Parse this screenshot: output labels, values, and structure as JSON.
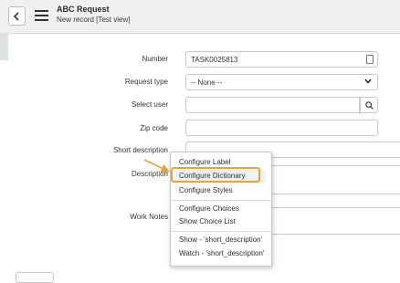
{
  "header": {
    "title": "ABC Request",
    "subtitle": "New record [Test view]"
  },
  "form": {
    "number": {
      "label": "Number",
      "value": "TASK0025813"
    },
    "request_type": {
      "label": "Request type",
      "value": "-- None --"
    },
    "select_user": {
      "label": "Select user",
      "value": ""
    },
    "zip_code": {
      "label": "Zip code",
      "value": ""
    },
    "short_description": {
      "label": "Short description",
      "value": ""
    },
    "description": {
      "label": "Description"
    },
    "work_notes": {
      "label": "Work Notes"
    }
  },
  "context_menu": {
    "items": [
      "Configure Label",
      "Configure Dictionary",
      "Configure Styles",
      "Configure Choices",
      "Show Choice List",
      "Show - 'short_description'",
      "Watch - 'short_description'"
    ],
    "highlighted_index": 1
  },
  "colors": {
    "highlight_border": "#e8a33c",
    "arrow": "#e8a33c"
  },
  "icons": [
    "chevron-left-icon",
    "hamburger-menu-icon",
    "reference-icon",
    "chevron-down-icon",
    "search-icon"
  ]
}
